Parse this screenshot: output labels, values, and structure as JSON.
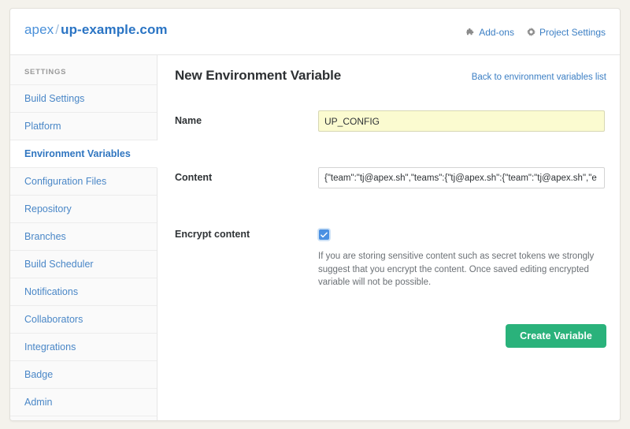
{
  "header": {
    "org": "apex",
    "separator": "/",
    "project": "up-example.com",
    "actions": [
      {
        "label": "Add-ons",
        "icon": "puzzle-piece-icon"
      },
      {
        "label": "Project Settings",
        "icon": "gear-icon"
      }
    ]
  },
  "sidebar": {
    "heading": "SETTINGS",
    "items": [
      {
        "label": "Build Settings",
        "active": false
      },
      {
        "label": "Platform",
        "active": false
      },
      {
        "label": "Environment Variables",
        "active": true
      },
      {
        "label": "Configuration Files",
        "active": false
      },
      {
        "label": "Repository",
        "active": false
      },
      {
        "label": "Branches",
        "active": false
      },
      {
        "label": "Build Scheduler",
        "active": false
      },
      {
        "label": "Notifications",
        "active": false
      },
      {
        "label": "Collaborators",
        "active": false
      },
      {
        "label": "Integrations",
        "active": false
      },
      {
        "label": "Badge",
        "active": false
      },
      {
        "label": "Admin",
        "active": false
      }
    ]
  },
  "main": {
    "title": "New Environment Variable",
    "back_link": "Back to environment variables list",
    "fields": {
      "name": {
        "label": "Name",
        "value": "UP_CONFIG",
        "placeholder": ""
      },
      "content": {
        "label": "Content",
        "value": "{\"team\":\"tj@apex.sh\",\"teams\":{\"tj@apex.sh\":{\"team\":\"tj@apex.sh\",\"e",
        "placeholder": ""
      },
      "encrypt": {
        "label": "Encrypt content",
        "checked": "true",
        "help": "If you are storing sensitive content such as secret tokens we strongly suggest that you encrypt the content. Once saved editing encrypted variable will not be possible."
      }
    },
    "submit_label": "Create Variable"
  },
  "colors": {
    "page_background": "#f4f2ec",
    "card_background": "#ffffff",
    "link_blue": "#3c7fc4",
    "accent_green": "#2ab27b",
    "checkbox_blue": "#4a90e2",
    "autofill_yellow": "#fbfbd0",
    "sidebar_background": "#fafafa"
  }
}
